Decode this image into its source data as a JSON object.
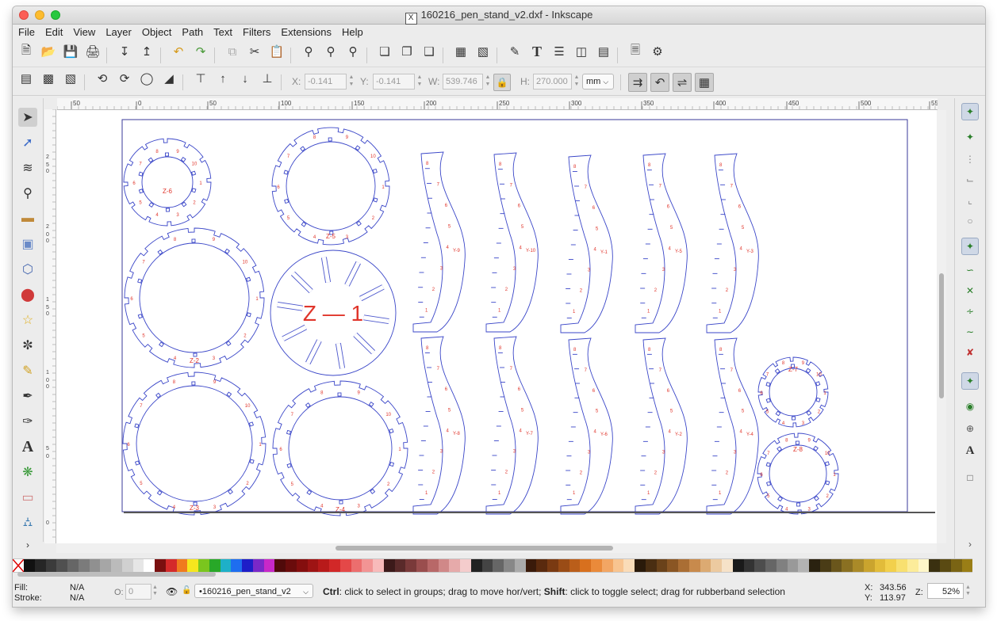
{
  "window": {
    "title": "160216_pen_stand_v2.dxf - Inkscape",
    "title_icon": "X"
  },
  "menu": [
    "File",
    "Edit",
    "View",
    "Layer",
    "Object",
    "Path",
    "Text",
    "Filters",
    "Extensions",
    "Help"
  ],
  "toolbar2": {
    "x_label": "X:",
    "x_value": "-0.141",
    "y_label": "Y:",
    "y_value": "-0.141",
    "w_label": "W:",
    "w_value": "539.746",
    "h_label": "H:",
    "h_value": "270.000",
    "unit": "mm"
  },
  "ruler": {
    "h_ticks": [
      "50",
      "0",
      "50",
      "100",
      "150",
      "200",
      "250",
      "300",
      "350",
      "400",
      "450",
      "500",
      "55"
    ],
    "v_ticks": [
      "2",
      "5",
      "0",
      "2",
      "0",
      "0",
      "1",
      "5",
      "0",
      "1",
      "0",
      "0",
      "5",
      "0",
      "0"
    ]
  },
  "drawing": {
    "labels": [
      "Z-6",
      "Z-5",
      "Z-1",
      "Z-2",
      "Z-3",
      "Z-4",
      "Z-7",
      "Z-8",
      "Y-10",
      "Y-9",
      "Y-1",
      "Y-5",
      "Y-3",
      "Y-8",
      "Y-7",
      "Y-6",
      "Y-2",
      "Y-4"
    ],
    "big_label": "Z — 1",
    "stroke_color": "#3a46c8",
    "text_color": "#e0352b"
  },
  "status": {
    "fill_label": "Fill:",
    "fill_value": "N/A",
    "stroke_label": "Stroke:",
    "stroke_value": "N/A",
    "opacity_label": "O:",
    "opacity_value": "0",
    "layer": "•160216_pen_stand_v2",
    "message_key1": "Ctrl",
    "message_part1": ": click to select in groups; drag to move hor/vert; ",
    "message_key2": "Shift",
    "message_part2": ": click to toggle select; drag for rubberband selection",
    "x_label": "X:",
    "x_value": "343.56",
    "y_label": "Y:",
    "y_value": "113.97",
    "zoom_label": "Z:",
    "zoom_value": "52%"
  },
  "palette": [
    "#111111",
    "#262626",
    "#3b3b3b",
    "#505050",
    "#666666",
    "#7b7b7b",
    "#909090",
    "#a6a6a6",
    "#bbbbbb",
    "#d0d0d0",
    "#e6e6e6",
    "#ffffff",
    "#7a1010",
    "#d42a2a",
    "#f07b1e",
    "#f6e61e",
    "#7ac61e",
    "#28a828",
    "#1eb0c8",
    "#1e6ef0",
    "#1e1ec8",
    "#7a28c8",
    "#c828c8",
    "#500a0a",
    "#6a0c0c",
    "#840e0e",
    "#9e1414",
    "#b81a1a",
    "#d22828",
    "#e44848",
    "#ec6e6e",
    "#f29494",
    "#f8baba",
    "#3c1a1a",
    "#5a2a2a",
    "#7a3a3a",
    "#9a4e4e",
    "#b86868",
    "#d08888",
    "#e6aaaa",
    "#f4cccc",
    "#222222",
    "#444444",
    "#666666",
    "#888888",
    "#aaaaaa",
    "#3a1a0a",
    "#5a2a0e",
    "#7a3a12",
    "#9a4c16",
    "#ba5e1a",
    "#d8701e",
    "#ea8a3a",
    "#f2a664",
    "#f8c490",
    "#fadcb8",
    "#2a1a0a",
    "#4a2e12",
    "#6a421a",
    "#8a5624",
    "#aa6e34",
    "#c88a4c",
    "#dcaa72",
    "#eccaa0",
    "#f6e2c8",
    "#1a1a1a",
    "#333333",
    "#4d4d4d",
    "#666666",
    "#808080",
    "#999999",
    "#b3b3b3",
    "#2a2210",
    "#4a3c16",
    "#6a561c",
    "#8a7022",
    "#aa8a28",
    "#caa42e",
    "#e2bc3a",
    "#f2d04c",
    "#f8e070",
    "#fcec9a",
    "#fef6c8",
    "#3a3010",
    "#5a4a12",
    "#7a6414",
    "#9a7e16"
  ]
}
